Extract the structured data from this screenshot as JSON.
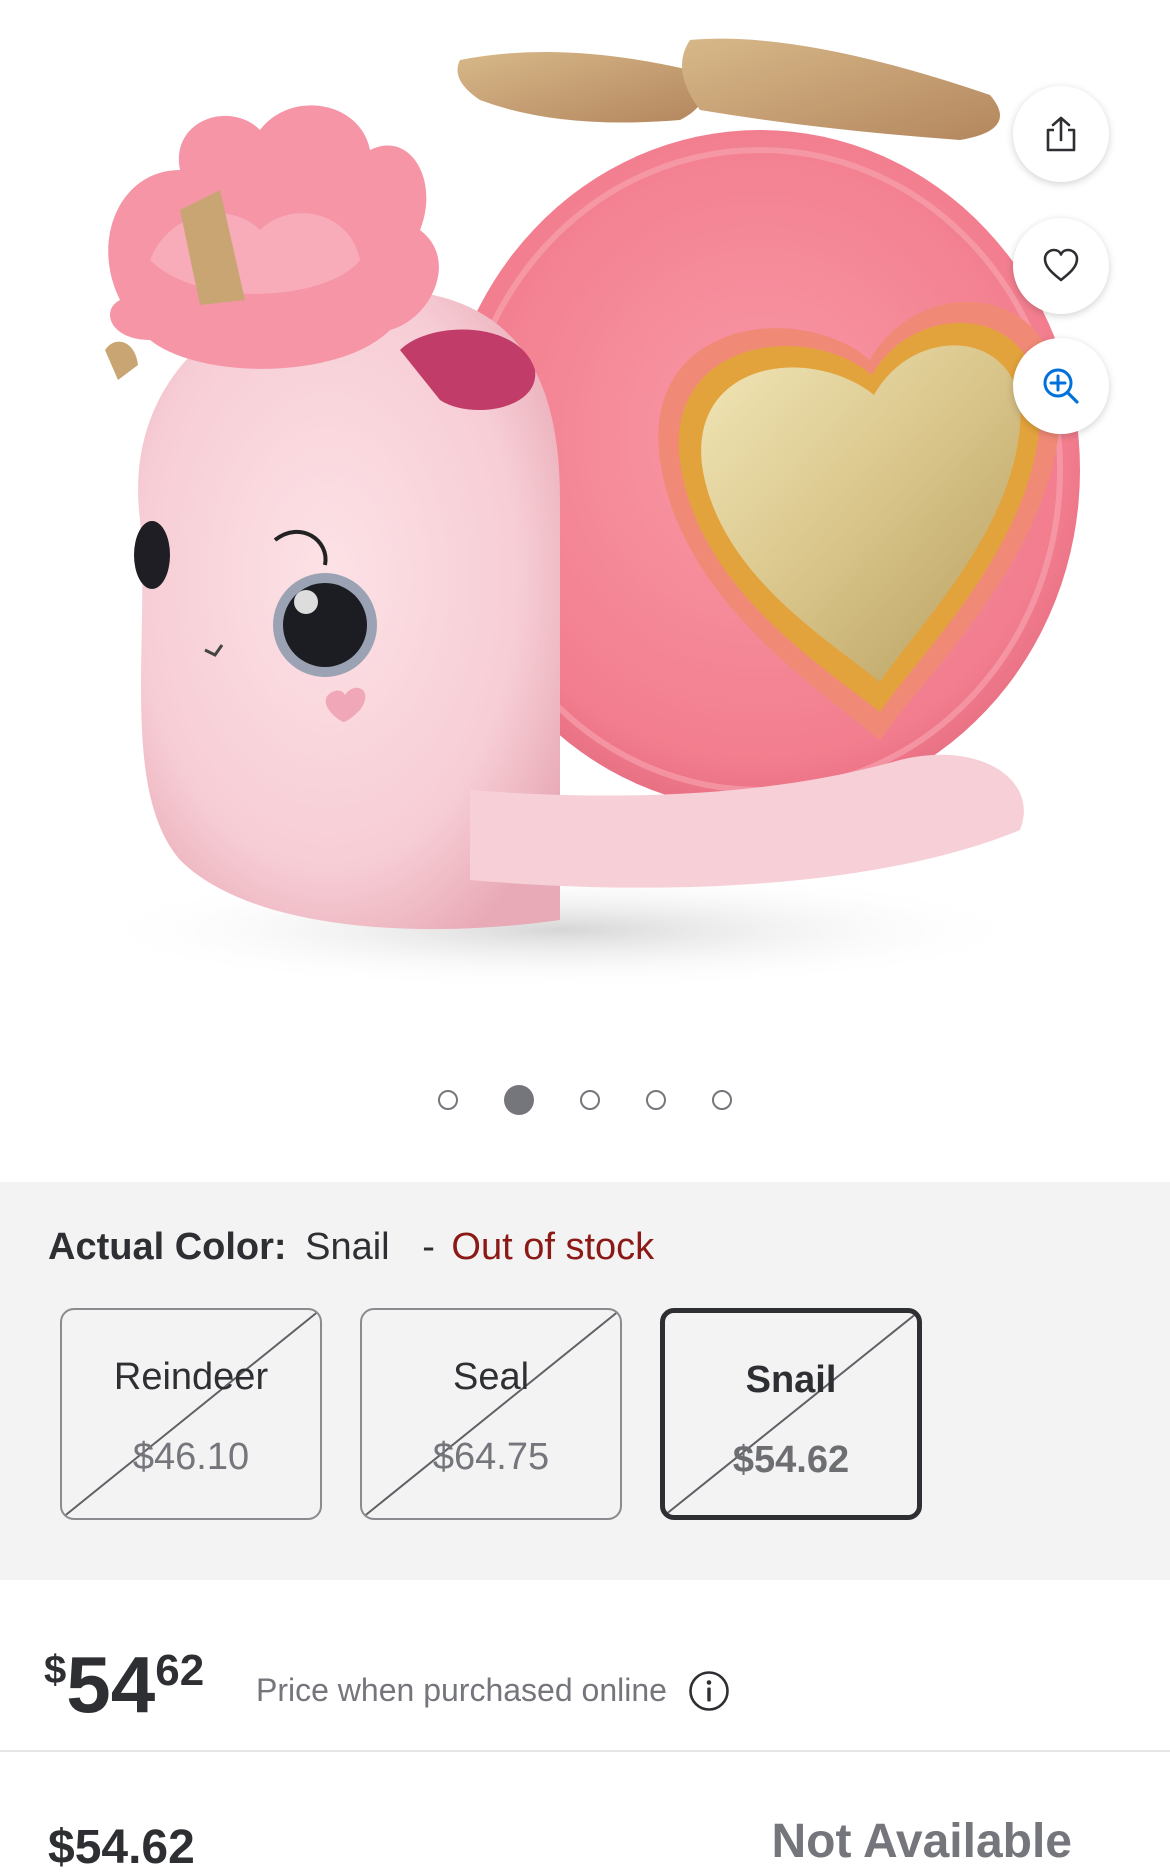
{
  "product": {
    "image_alt": "Pink plush snail toy with glittery gold heart shell and pink fluffy hair"
  },
  "actions": {
    "share_icon": "share-icon",
    "favorite_icon": "heart-icon",
    "zoom_icon": "zoom-in-icon"
  },
  "carousel": {
    "total": 5,
    "active_index": 2
  },
  "color_selector": {
    "label": "Actual Color:",
    "selected_value": "Snail",
    "separator": "-",
    "status": "Out of stock",
    "status_color": "#8b1a17",
    "options": [
      {
        "name": "Reindeer",
        "price": "$46.10",
        "selected": false,
        "unavailable": true
      },
      {
        "name": "Seal",
        "price": "$64.75",
        "selected": false,
        "unavailable": true
      },
      {
        "name": "Snail",
        "price": "$54.62",
        "selected": true,
        "unavailable": true
      }
    ]
  },
  "price": {
    "currency": "$",
    "dollars": "54",
    "cents": "62",
    "note": "Price when purchased online",
    "info_icon": "info-icon"
  },
  "footer": {
    "price": "$54.62",
    "availability": "Not Available"
  }
}
